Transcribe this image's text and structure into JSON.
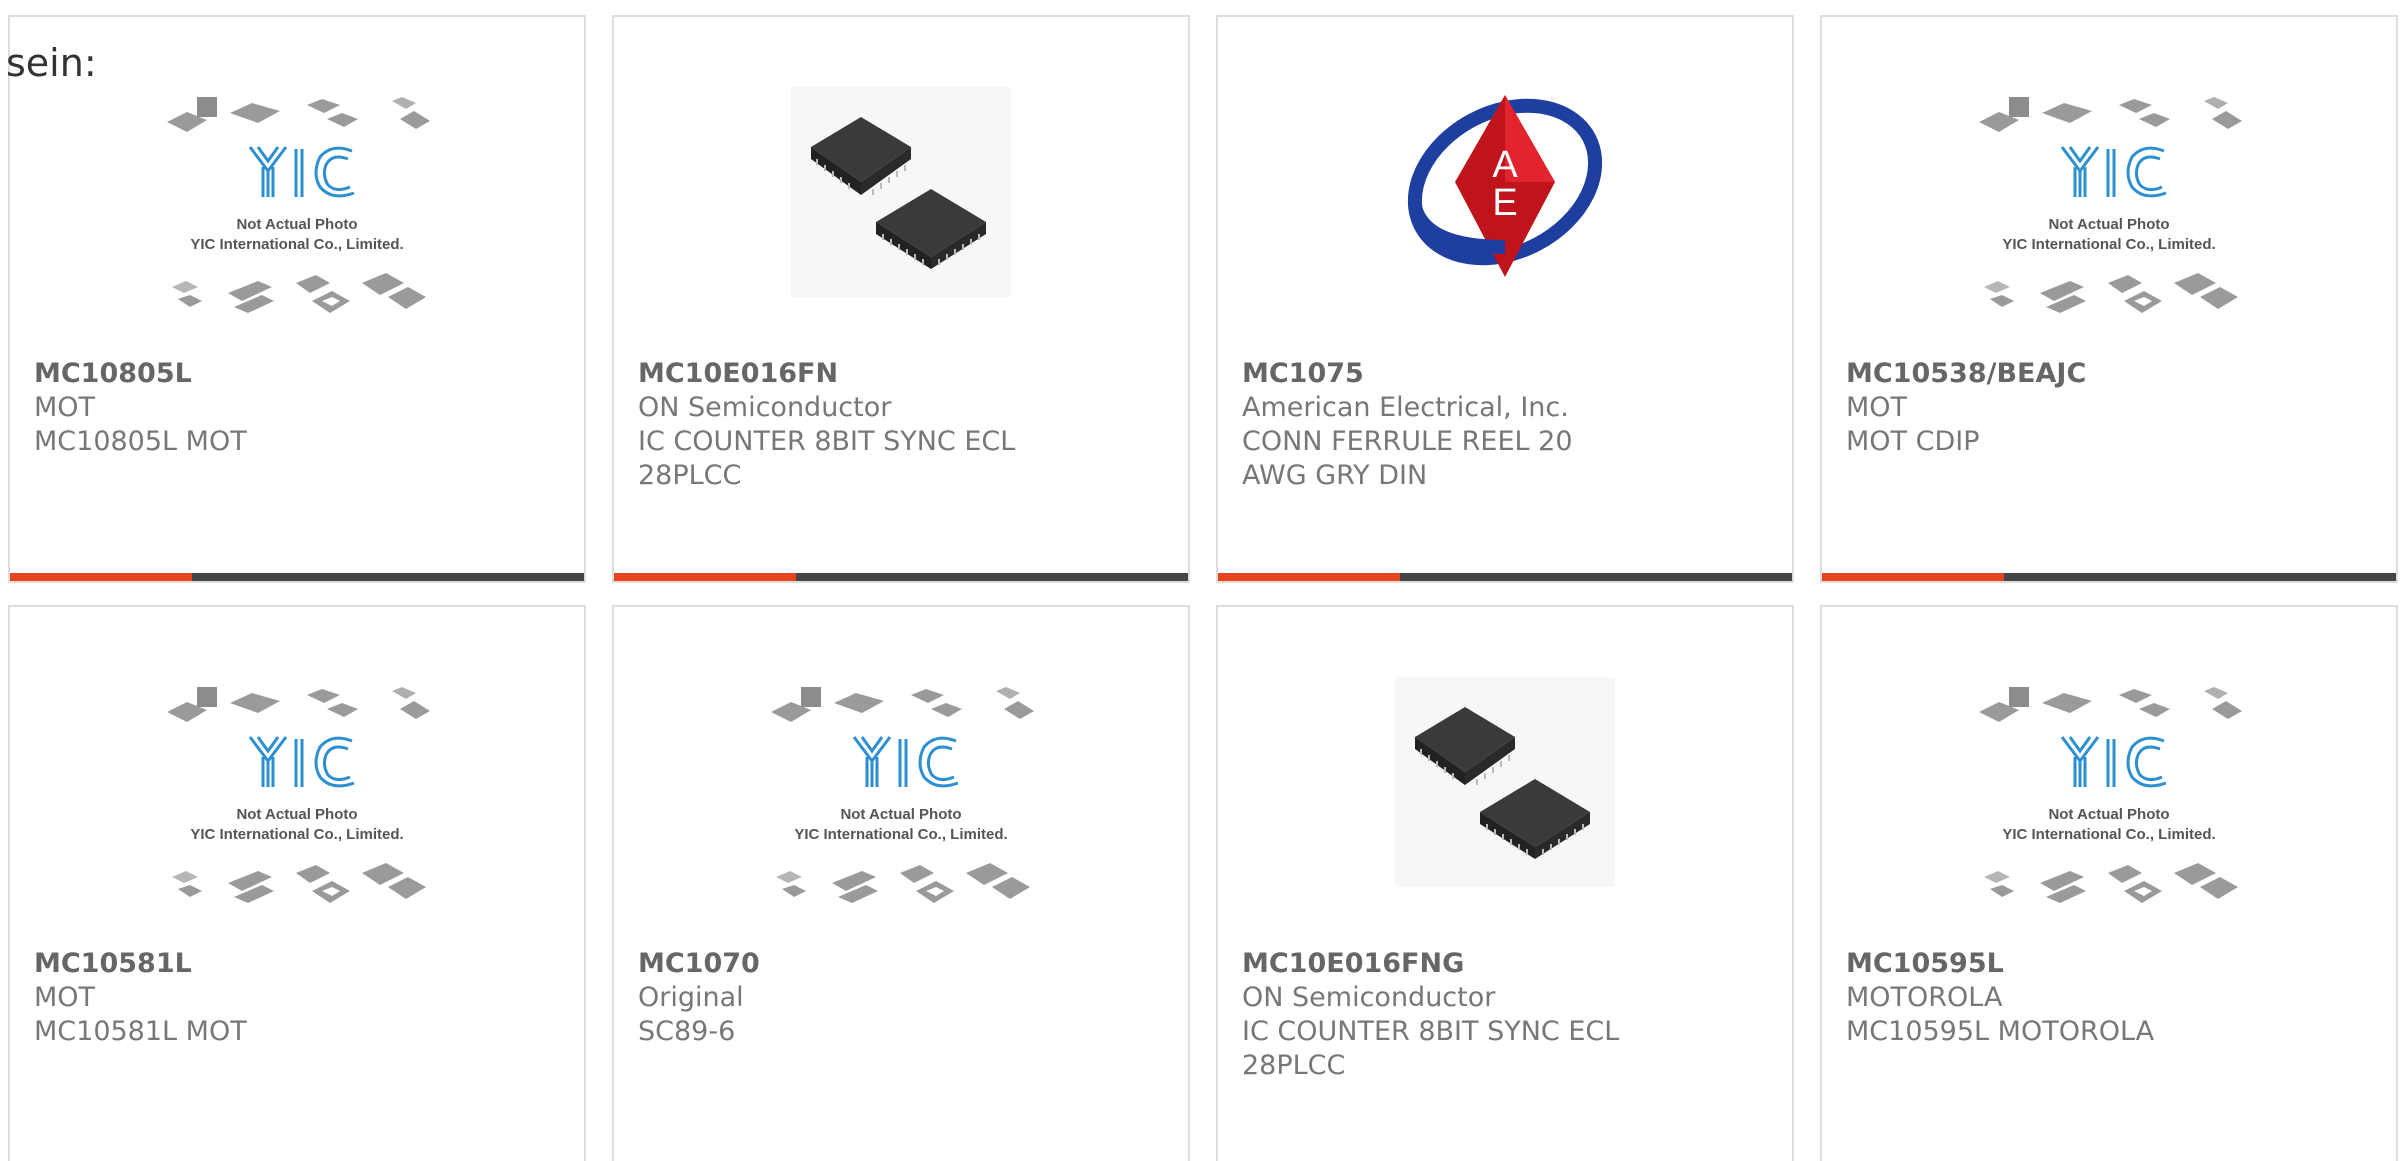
{
  "intro": "sein:",
  "colors": {
    "accent": "#e8431b",
    "bar": "#444444",
    "border": "#dddddd",
    "text": "#777777"
  },
  "placeholder_image": {
    "line1": "Not Actual Photo",
    "line2": "YIC International Co., Limited."
  },
  "products": [
    {
      "part": "MC10805L",
      "maker": "MOT",
      "desc": "MC10805L MOT",
      "image": "yic-placeholder-icon"
    },
    {
      "part": "MC10E016FN",
      "maker": "ON Semiconductor",
      "desc": "IC COUNTER 8BIT SYNC ECL 28PLCC",
      "image": "plcc-chip-icon"
    },
    {
      "part": "MC1075",
      "maker": "American Electrical, Inc.",
      "desc": "CONN FERRULE REEL 20 AWG GRY DIN",
      "image": "ae-logo-icon"
    },
    {
      "part": "MC10538/BEAJC",
      "maker": "MOT",
      "desc": "MOT CDIP",
      "image": "yic-placeholder-icon"
    },
    {
      "part": "MC10581L",
      "maker": "MOT",
      "desc": "MC10581L MOT",
      "image": "yic-placeholder-icon"
    },
    {
      "part": "MC1070",
      "maker": "Original",
      "desc": "SC89-6",
      "image": "yic-placeholder-icon"
    },
    {
      "part": "MC10E016FNG",
      "maker": "ON Semiconductor",
      "desc": "IC COUNTER 8BIT SYNC ECL 28PLCC",
      "image": "plcc-chip-icon"
    },
    {
      "part": "MC10595L",
      "maker": "MOTOROLA",
      "desc": "MC10595L MOTOROLA",
      "image": "yic-placeholder-icon"
    }
  ]
}
